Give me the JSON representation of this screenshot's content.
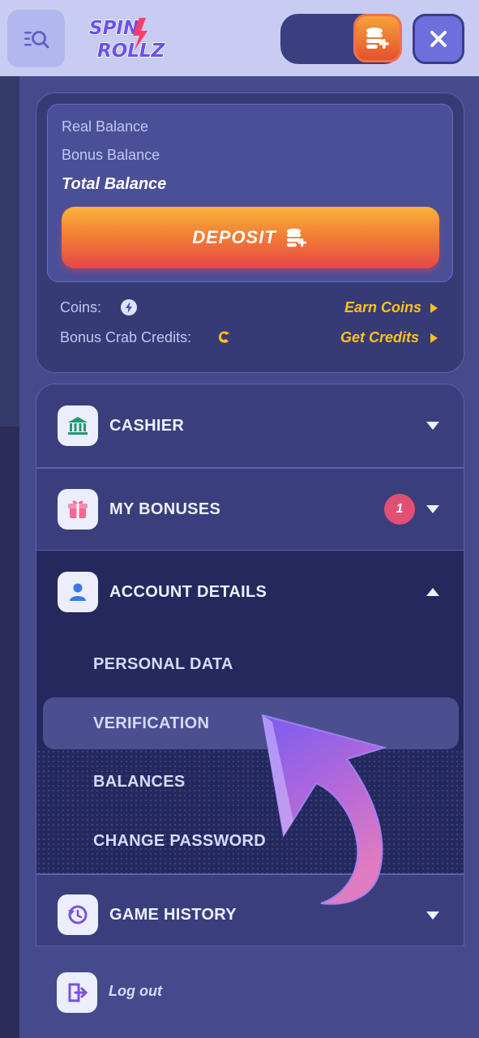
{
  "header": {
    "brand": "SPIN ROLLZ",
    "brand_line1": "SPIN",
    "brand_line2": "ROLLZ",
    "menu_icon": "search-menu-icon",
    "coin_add_icon": "coins-plus-icon",
    "close_icon": "close-icon"
  },
  "balance": {
    "real_label": "Real Balance",
    "bonus_label": "Bonus Balance",
    "total_label": "Total Balance",
    "deposit_label": "DEPOSIT",
    "coins_label": "Coins:",
    "coins_link": "Earn Coins",
    "credits_label": "Bonus Crab Credits:",
    "credits_link": "Get Credits"
  },
  "menu": {
    "items": [
      {
        "label": "CASHIER",
        "icon": "bank-icon",
        "expanded": false
      },
      {
        "label": "MY BONUSES",
        "icon": "gift-icon",
        "badge": "1",
        "expanded": false
      },
      {
        "label": "ACCOUNT DETAILS",
        "icon": "user-icon",
        "expanded": true
      },
      {
        "label": "GAME HISTORY",
        "icon": "history-icon",
        "expanded": false
      }
    ],
    "sub_items": [
      "PERSONAL DATA",
      "VERIFICATION",
      "BALANCES",
      "CHANGE PASSWORD"
    ],
    "active_sub_item": "VERIFICATION"
  },
  "footer": {
    "logout_label": "Log out",
    "logout_icon": "logout-icon"
  },
  "colors": {
    "accent_gold": "#ffc21a",
    "deposit_gradient_top": "#fbb33a",
    "deposit_gradient_bottom": "#e5484a",
    "badge": "#e14f72",
    "panel": "#3a3e7c",
    "header": "#c9ccf2"
  }
}
